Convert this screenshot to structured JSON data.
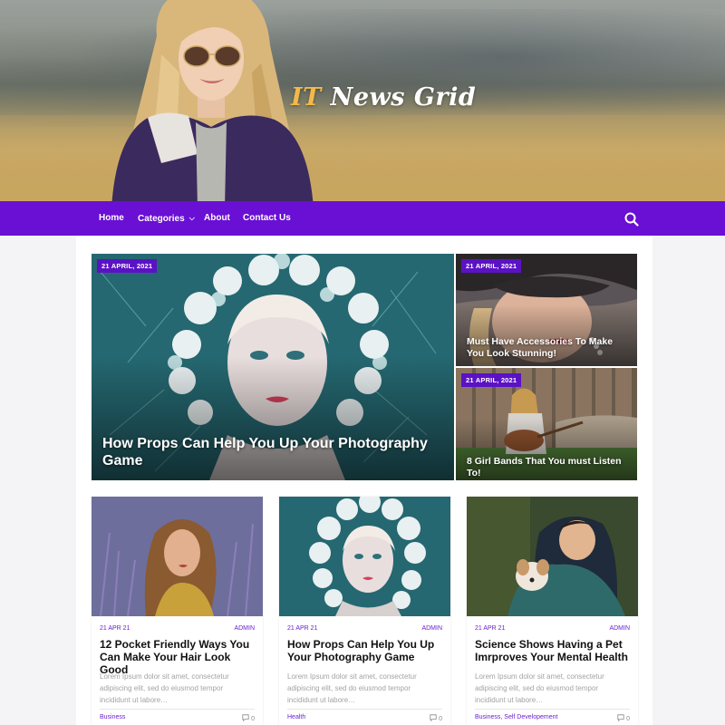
{
  "site": {
    "logo_accent": "IT",
    "logo_rest": " News Grid"
  },
  "nav": {
    "items": [
      {
        "label": "Home"
      },
      {
        "label": "Categories",
        "icon": "chevron-down-icon"
      },
      {
        "label": "About"
      },
      {
        "label": "Contact Us"
      }
    ],
    "search_icon": "search-icon"
  },
  "featured": [
    {
      "date": "21 APRIL, 2021",
      "title": "How Props Can Help You Up Your Photography Game"
    },
    {
      "date": "21 APRIL, 2021",
      "title": "Must Have Accessories To Make You Look Stunning!"
    },
    {
      "date": "21 APRIL, 2021",
      "title": "8 Girl Bands That You must Listen To!"
    }
  ],
  "cards": [
    {
      "date": "21 APR 21",
      "author": "ADMIN",
      "title": "12 Pocket Friendly Ways You Can Make Your Hair Look Good",
      "excerpt": "Lorem Ipsum dolor sit amet, consectetur adipiscing elit, sed do eiusmod tempor incididunt ut labore…",
      "category": "Business",
      "comments": "0"
    },
    {
      "date": "21 APR 21",
      "author": "ADMIN",
      "title": "How Props Can Help You Up Your Photography Game",
      "excerpt": "Lorem Ipsum dolor sit amet, consectetur adipiscing elit, sed do eiusmod tempor incididunt ut labore…",
      "category": "Health",
      "comments": "0"
    },
    {
      "date": "21 APR 21",
      "author": "ADMIN",
      "title": "Science Shows Having a Pet Imrproves Your Mental Health",
      "excerpt": "Lorem Ipsum dolor sit amet, consectetur adipiscing elit, sed do eiusmod tempor incididunt ut labore…",
      "category": "Business, Self Developement",
      "comments": "0"
    }
  ],
  "colors": {
    "brand": "#6a0fd4",
    "accent": "#f2b94a",
    "badge": "#5b12c4",
    "meta": "#6a1fd0"
  }
}
